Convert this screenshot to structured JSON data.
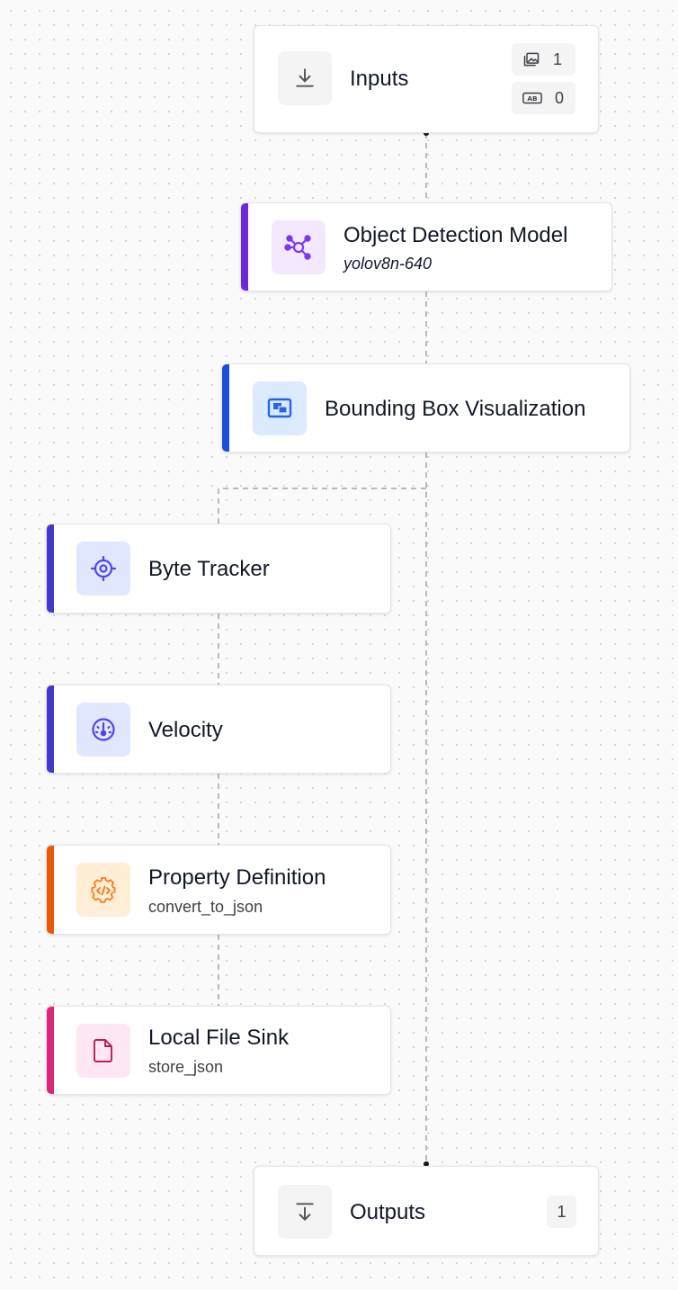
{
  "workflow": {
    "inputs": {
      "title": "Inputs",
      "icon": "download-icon",
      "image_count": "1",
      "text_count": "0"
    },
    "steps": [
      {
        "title": "Object Detection Model",
        "subtitle": "yolov8n-640",
        "icon": "network-hub-icon",
        "accent": "#6d28d9",
        "icon_color": "#7c3aed",
        "icon_bg": "#f3e8ff"
      },
      {
        "title": "Bounding Box Visualization",
        "subtitle": "",
        "icon": "bounding-box-icon",
        "accent": "#1d4ed8",
        "icon_color": "#2563eb",
        "icon_bg": "#dbeafe"
      },
      {
        "title": "Byte Tracker",
        "subtitle": "",
        "icon": "crosshair-target-icon",
        "accent": "#4338ca",
        "icon_color": "#4f46e5",
        "icon_bg": "#e0e7ff"
      },
      {
        "title": "Velocity",
        "subtitle": "",
        "icon": "speedometer-icon",
        "accent": "#4338ca",
        "icon_color": "#4f46e5",
        "icon_bg": "#e0e7ff"
      },
      {
        "title": "Property Definition",
        "subtitle": "convert_to_json",
        "icon": "gear-code-icon",
        "accent": "#ea580c",
        "icon_color": "#f97316",
        "icon_bg": "#ffedd5"
      },
      {
        "title": "Local File Sink",
        "subtitle": "store_json",
        "icon": "file-icon",
        "accent": "#db2777",
        "icon_color": "#be185d",
        "icon_bg": "#fce7f3"
      }
    ],
    "outputs": {
      "title": "Outputs",
      "icon": "download-to-bottom-icon",
      "count": "1"
    }
  }
}
